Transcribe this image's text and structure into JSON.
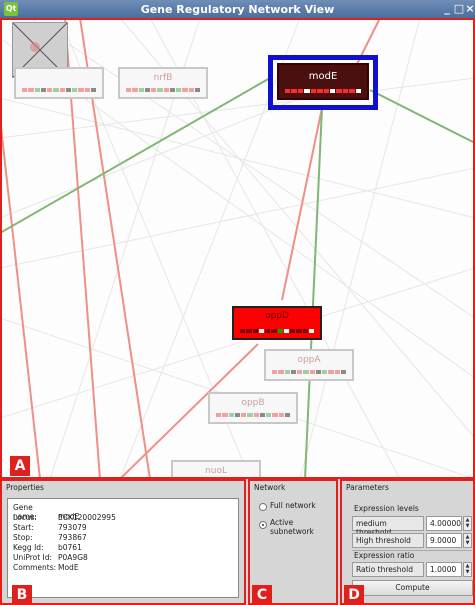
{
  "window": {
    "title": "Gene Regulatory Network View",
    "logo": "Qt",
    "minimize": "_",
    "restore": "□",
    "close": "×"
  },
  "network": {
    "nodes": [
      {
        "label": ""
      },
      {
        "label": "nrfB"
      },
      {
        "label": "modE"
      },
      {
        "label": "oppD"
      },
      {
        "label": "oppA"
      },
      {
        "label": "oppB"
      },
      {
        "label": "nuoL"
      }
    ],
    "colors": {
      "inhibition": "#f08f86",
      "activation": "#7fb872",
      "selection": "#1010d0",
      "annotation": "#e0201c"
    }
  },
  "annotations": {
    "a": "A",
    "b": "B",
    "c": "C",
    "d": "D"
  },
  "properties": {
    "title": "Properties",
    "rows": [
      {
        "key": "Gene name:",
        "value": "modE"
      },
      {
        "key": "Locus:",
        "value": "ECK120002995"
      },
      {
        "key": "Start:",
        "value": "793079"
      },
      {
        "key": "Stop:",
        "value": "793867"
      },
      {
        "key": "Kegg Id:",
        "value": "b0761"
      },
      {
        "key": "UniProt Id:",
        "value": "P0A9G8"
      },
      {
        "key": "Comments:",
        "value": "ModE"
      }
    ]
  },
  "network_panel": {
    "title": "Network",
    "options": [
      {
        "label": "Full network"
      },
      {
        "label": "Active",
        "label2": "subnetwork"
      }
    ]
  },
  "parameters": {
    "title": "Parameters",
    "expression_levels": "Expression levels",
    "medium_label": "medium threshold",
    "medium_value": "4.00000",
    "high_label": "High threshold",
    "high_value": "9.0000",
    "expression_ratio": "Expression ratio",
    "ratio_label": "Ratio threshold",
    "ratio_value": "1.0000",
    "compute": "Compute"
  }
}
